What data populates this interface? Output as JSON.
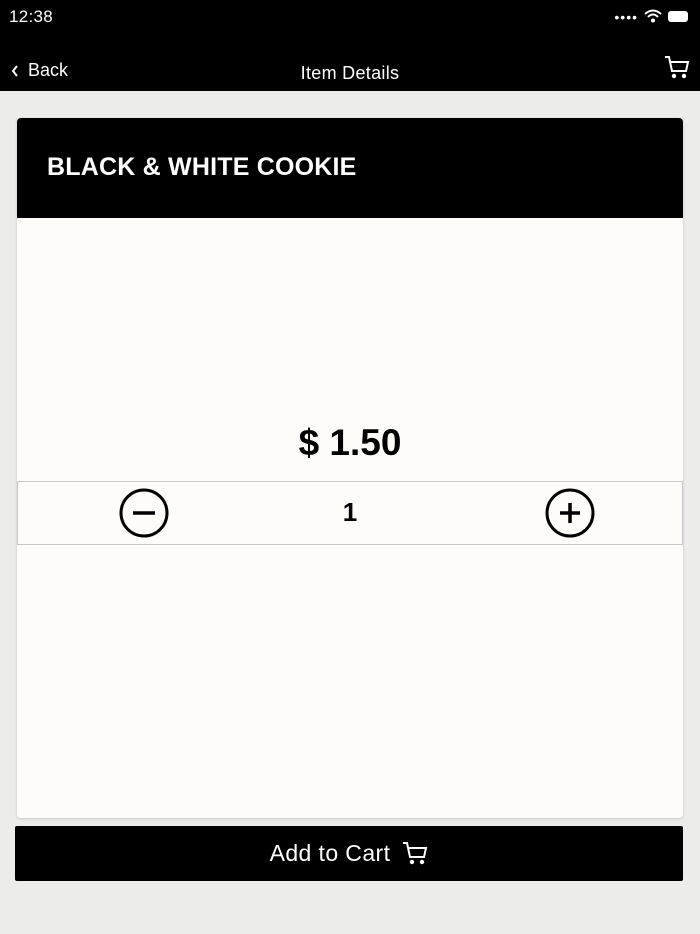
{
  "status_bar": {
    "time": "12:38",
    "signal_icon": "signal-dots-icon",
    "wifi_icon": "wifi-icon",
    "battery_icon": "battery-icon"
  },
  "nav": {
    "back_label": "Back",
    "back_icon": "chevron-left-icon",
    "title": "Item Details",
    "cart_icon": "cart-icon"
  },
  "item": {
    "name": "BLACK & WHITE COOKIE",
    "price": "$ 1.50",
    "quantity": "1",
    "decrement_icon": "minus-circle-icon",
    "increment_icon": "plus-circle-icon"
  },
  "actions": {
    "add_to_cart_label": "Add to Cart",
    "add_to_cart_icon": "cart-icon"
  },
  "colors": {
    "header_background": "#000000",
    "card_background": "#fdfcf8",
    "page_background": "#ececea",
    "text_on_dark": "#ffffff"
  }
}
